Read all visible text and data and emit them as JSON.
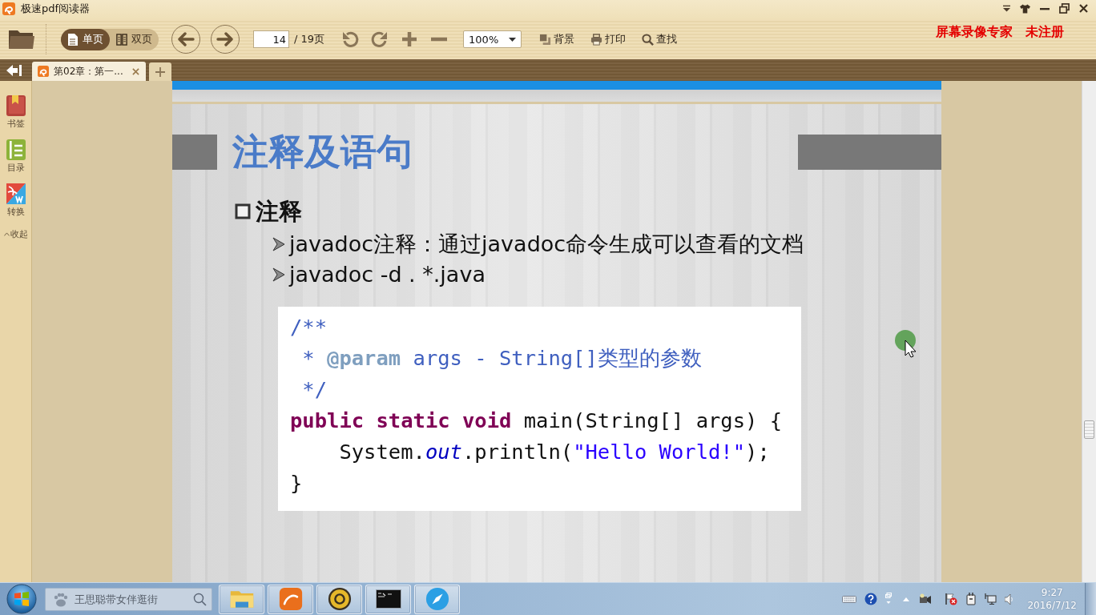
{
  "window": {
    "title": "极速pdf阅读器"
  },
  "toolbar": {
    "view_modes": [
      {
        "label": "单页",
        "selected": true
      },
      {
        "label": "双页",
        "selected": false
      }
    ],
    "page_input": {
      "value": "14"
    },
    "page_total": "/ 19页",
    "zoom_select": {
      "value": "100%"
    },
    "actions": [
      {
        "label": "背景"
      },
      {
        "label": "打印"
      },
      {
        "label": "查找"
      }
    ],
    "recorder_notice": "屏幕录像专家 未注册"
  },
  "tabs": [
    {
      "label": "第02章：第一...",
      "selected": true
    }
  ],
  "sidebar": {
    "items": [
      {
        "label": "书签"
      },
      {
        "label": "目录"
      },
      {
        "label": "转换"
      }
    ],
    "collapse_label": "收起"
  },
  "slide": {
    "title": "注释及语句",
    "heading": "注释",
    "bullets": [
      "javadoc注释：通过javadoc命令生成可以查看的文档",
      "javadoc -d . *.java"
    ],
    "code": {
      "lines": [
        {
          "tokens": [
            {
              "text": "/**",
              "kind": "comment"
            }
          ]
        },
        {
          "tokens": [
            {
              "text": " * ",
              "kind": "comment"
            },
            {
              "text": "@param",
              "kind": "doctag"
            },
            {
              "text": " args - String[]类型的参数",
              "kind": "comment"
            }
          ]
        },
        {
          "tokens": [
            {
              "text": " */",
              "kind": "comment"
            }
          ]
        },
        {
          "tokens": [
            {
              "text": "public static void",
              "kind": "keyword"
            },
            {
              "text": " main(String[] args) {",
              "kind": "plain"
            }
          ]
        },
        {
          "tokens": [
            {
              "text": "    System.",
              "kind": "plain"
            },
            {
              "text": "out",
              "kind": "field"
            },
            {
              "text": ".println(",
              "kind": "plain"
            },
            {
              "text": "\"Hello World!\"",
              "kind": "string"
            },
            {
              "text": ");",
              "kind": "plain"
            }
          ]
        },
        {
          "tokens": [
            {
              "text": "}",
              "kind": "plain"
            }
          ]
        }
      ]
    }
  },
  "taskbar": {
    "search": {
      "placeholder": "王思聪带女伴逛街"
    },
    "clock": {
      "time": "9:27",
      "date": "2016/7/12"
    }
  }
}
